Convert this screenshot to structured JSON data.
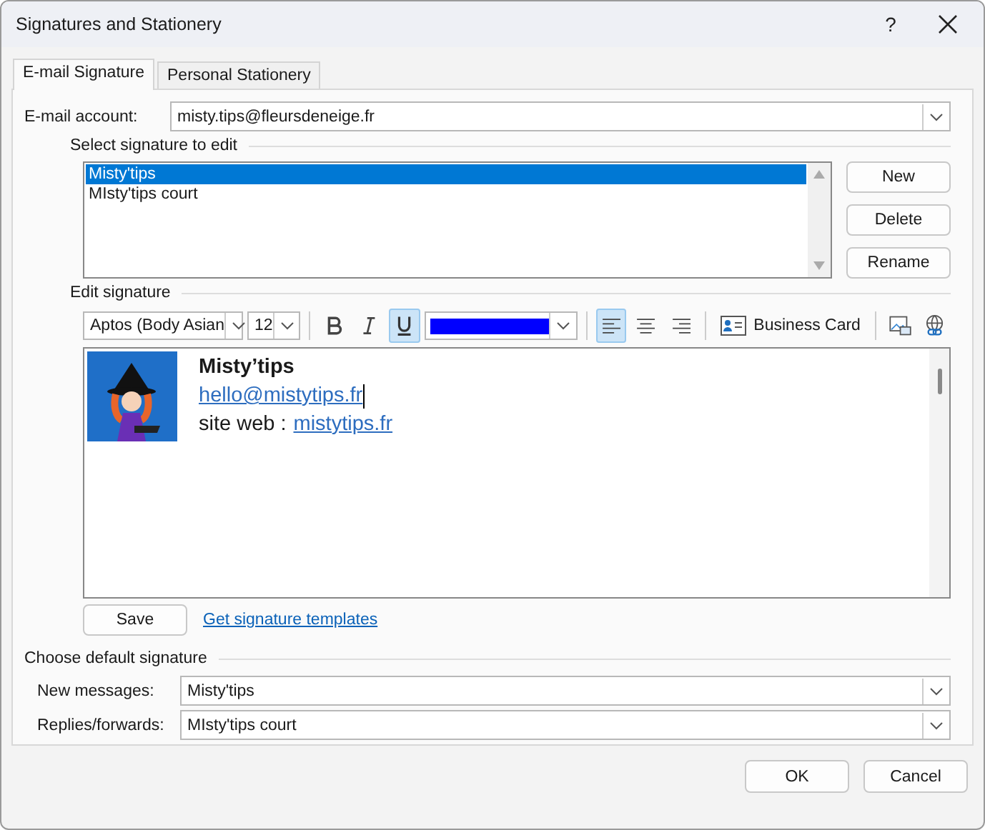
{
  "window": {
    "title": "Signatures and Stationery",
    "help": "?"
  },
  "tabs": [
    {
      "label": "E-mail Signature",
      "selected": true
    },
    {
      "label": "Personal Stationery",
      "selected": false
    }
  ],
  "account": {
    "label": "E-mail account:",
    "value": "misty.tips@fleursdeneige.fr"
  },
  "signatures": {
    "label": "Select signature to edit",
    "items": [
      {
        "name": "Misty'tips",
        "selected": true
      },
      {
        "name": "MIsty'tips court",
        "selected": false
      }
    ],
    "buttons": [
      "New",
      "Delete",
      "Rename"
    ]
  },
  "editor": {
    "label": "Edit signature",
    "font": "Aptos (Body Asian",
    "size": "12",
    "bold": false,
    "italic": false,
    "underline": true,
    "align": [
      {
        "kind": "left",
        "selected": true
      },
      {
        "kind": "center",
        "selected": false
      },
      {
        "kind": "right",
        "selected": false
      }
    ],
    "business_card": "Business Card",
    "content": {
      "name": "Misty’tips",
      "email": "hello@mistytips.fr",
      "web_label": "site web :",
      "web_link": "mistytips.fr"
    },
    "save": "Save",
    "templates_link": "Get signature templates"
  },
  "defaults": {
    "label": "Choose default signature",
    "fields": [
      {
        "label": "New messages:",
        "value": "Misty'tips"
      },
      {
        "label": "Replies/forwards:",
        "value": "MIsty'tips court"
      }
    ]
  },
  "buttons": [
    "OK",
    "Cancel"
  ]
}
